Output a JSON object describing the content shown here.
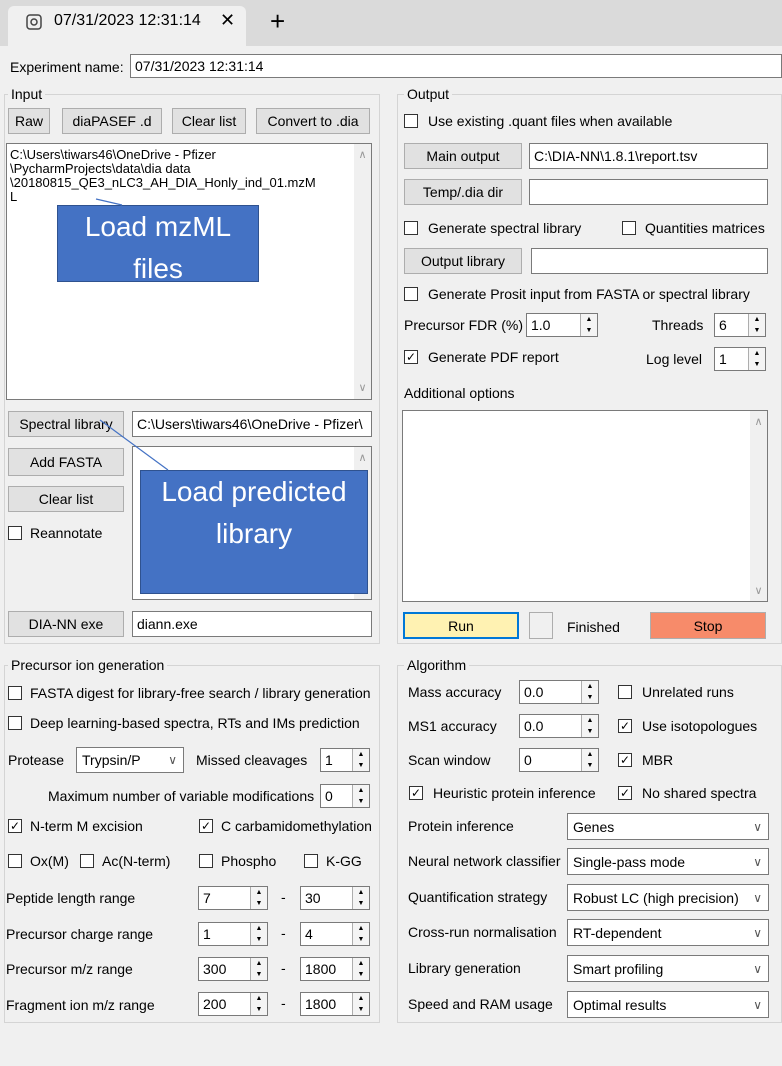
{
  "tab": {
    "title": "07/31/2023 12:31:14",
    "close": "✕",
    "add": "+"
  },
  "experiment": {
    "label": "Experiment name:",
    "value": "07/31/2023 12:31:14"
  },
  "input": {
    "group_label": "Input",
    "buttons": {
      "raw": "Raw",
      "diapasef": "diaPASEF .d",
      "clear": "Clear list",
      "convert": "Convert to .dia"
    },
    "file_list": [
      "C:\\Users\\tiwars46\\OneDrive - Pfizer",
      "\\PycharmProjects\\data\\dia data",
      "\\20180815_QE3_nLC3_AH_DIA_Honly_ind_01.mzM",
      "L"
    ],
    "spectral_library_button": "Spectral library",
    "spectral_library_path": "C:\\Users\\tiwars46\\OneDrive - Pfizer\\",
    "add_fasta": "Add FASTA",
    "clear_list": "Clear list",
    "reannotate": "Reannotate",
    "diann_exe_button": "DIA-NN exe",
    "diann_exe_value": "diann.exe"
  },
  "callouts": {
    "mzml": "Load mzML files",
    "library": "Load predicted library"
  },
  "output": {
    "group_label": "Output",
    "use_existing": "Use existing .quant files when available",
    "main_output_button": "Main output",
    "main_output_value": "C:\\DIA-NN\\1.8.1\\report.tsv",
    "temp_dir_button": "Temp/.dia dir",
    "gen_spectral_lib": "Generate spectral library",
    "quant_matrices": "Quantities matrices",
    "output_library_button": "Output library",
    "gen_prosit": "Generate Prosit input from FASTA or spectral library",
    "precursor_fdr_label": "Precursor FDR (%)",
    "precursor_fdr_value": "1.0",
    "threads_label": "Threads",
    "threads_value": "6",
    "gen_pdf": "Generate PDF report",
    "log_level_label": "Log level",
    "log_level_value": "1",
    "additional_options": "Additional options",
    "run": "Run",
    "finished": "Finished",
    "stop": "Stop"
  },
  "precursor": {
    "group_label": "Precursor ion generation",
    "fasta_digest": "FASTA digest for library-free search / library generation",
    "deep_learning": "Deep learning-based spectra, RTs and IMs prediction",
    "protease_label": "Protease",
    "protease_value": "Trypsin/P",
    "missed_cleavages_label": "Missed cleavages",
    "missed_cleavages_value": "1",
    "max_var_mods_label": "Maximum number of variable modifications",
    "max_var_mods_value": "0",
    "nterm_m": "N-term M excision",
    "c_carb": "C carbamidomethylation",
    "ox": "Ox(M)",
    "ac": "Ac(N-term)",
    "phospho": "Phospho",
    "kgg": "K-GG",
    "peptide_length_label": "Peptide length range",
    "peptide_length_min": "7",
    "peptide_length_max": "30",
    "charge_label": "Precursor charge range",
    "charge_min": "1",
    "charge_max": "4",
    "mz_label": "Precursor m/z range",
    "mz_min": "300",
    "mz_max": "1800",
    "frag_label": "Fragment ion m/z range",
    "frag_min": "200",
    "frag_max": "1800",
    "dash": "-"
  },
  "algorithm": {
    "group_label": "Algorithm",
    "mass_acc_label": "Mass accuracy",
    "mass_acc_value": "0.0",
    "unrelated_runs": "Unrelated runs",
    "ms1_acc_label": "MS1 accuracy",
    "ms1_acc_value": "0.0",
    "use_isotopologues": "Use isotopologues",
    "scan_window_label": "Scan window",
    "scan_window_value": "0",
    "mbr": "MBR",
    "heuristic": "Heuristic protein inference",
    "no_shared": "No shared spectra",
    "protein_inference_label": "Protein inference",
    "protein_inference_value": "Genes",
    "nn_label": "Neural network classifier",
    "nn_value": "Single-pass mode",
    "quant_label": "Quantification strategy",
    "quant_value": "Robust LC (high precision)",
    "norm_label": "Cross-run normalisation",
    "norm_value": "RT-dependent",
    "libgen_label": "Library generation",
    "libgen_value": "Smart profiling",
    "speed_label": "Speed and RAM usage",
    "speed_value": "Optimal results"
  },
  "glyphs": {
    "check": "✓",
    "up": "▲",
    "down": "▼",
    "chev": "∨",
    "scroll_up": "∧",
    "scroll_down": "∨"
  },
  "colors": {
    "run_bg": "#fff2b2",
    "run_border": "#0078d7",
    "stop_bg": "#f78b6a",
    "callout": "#4472c4"
  }
}
